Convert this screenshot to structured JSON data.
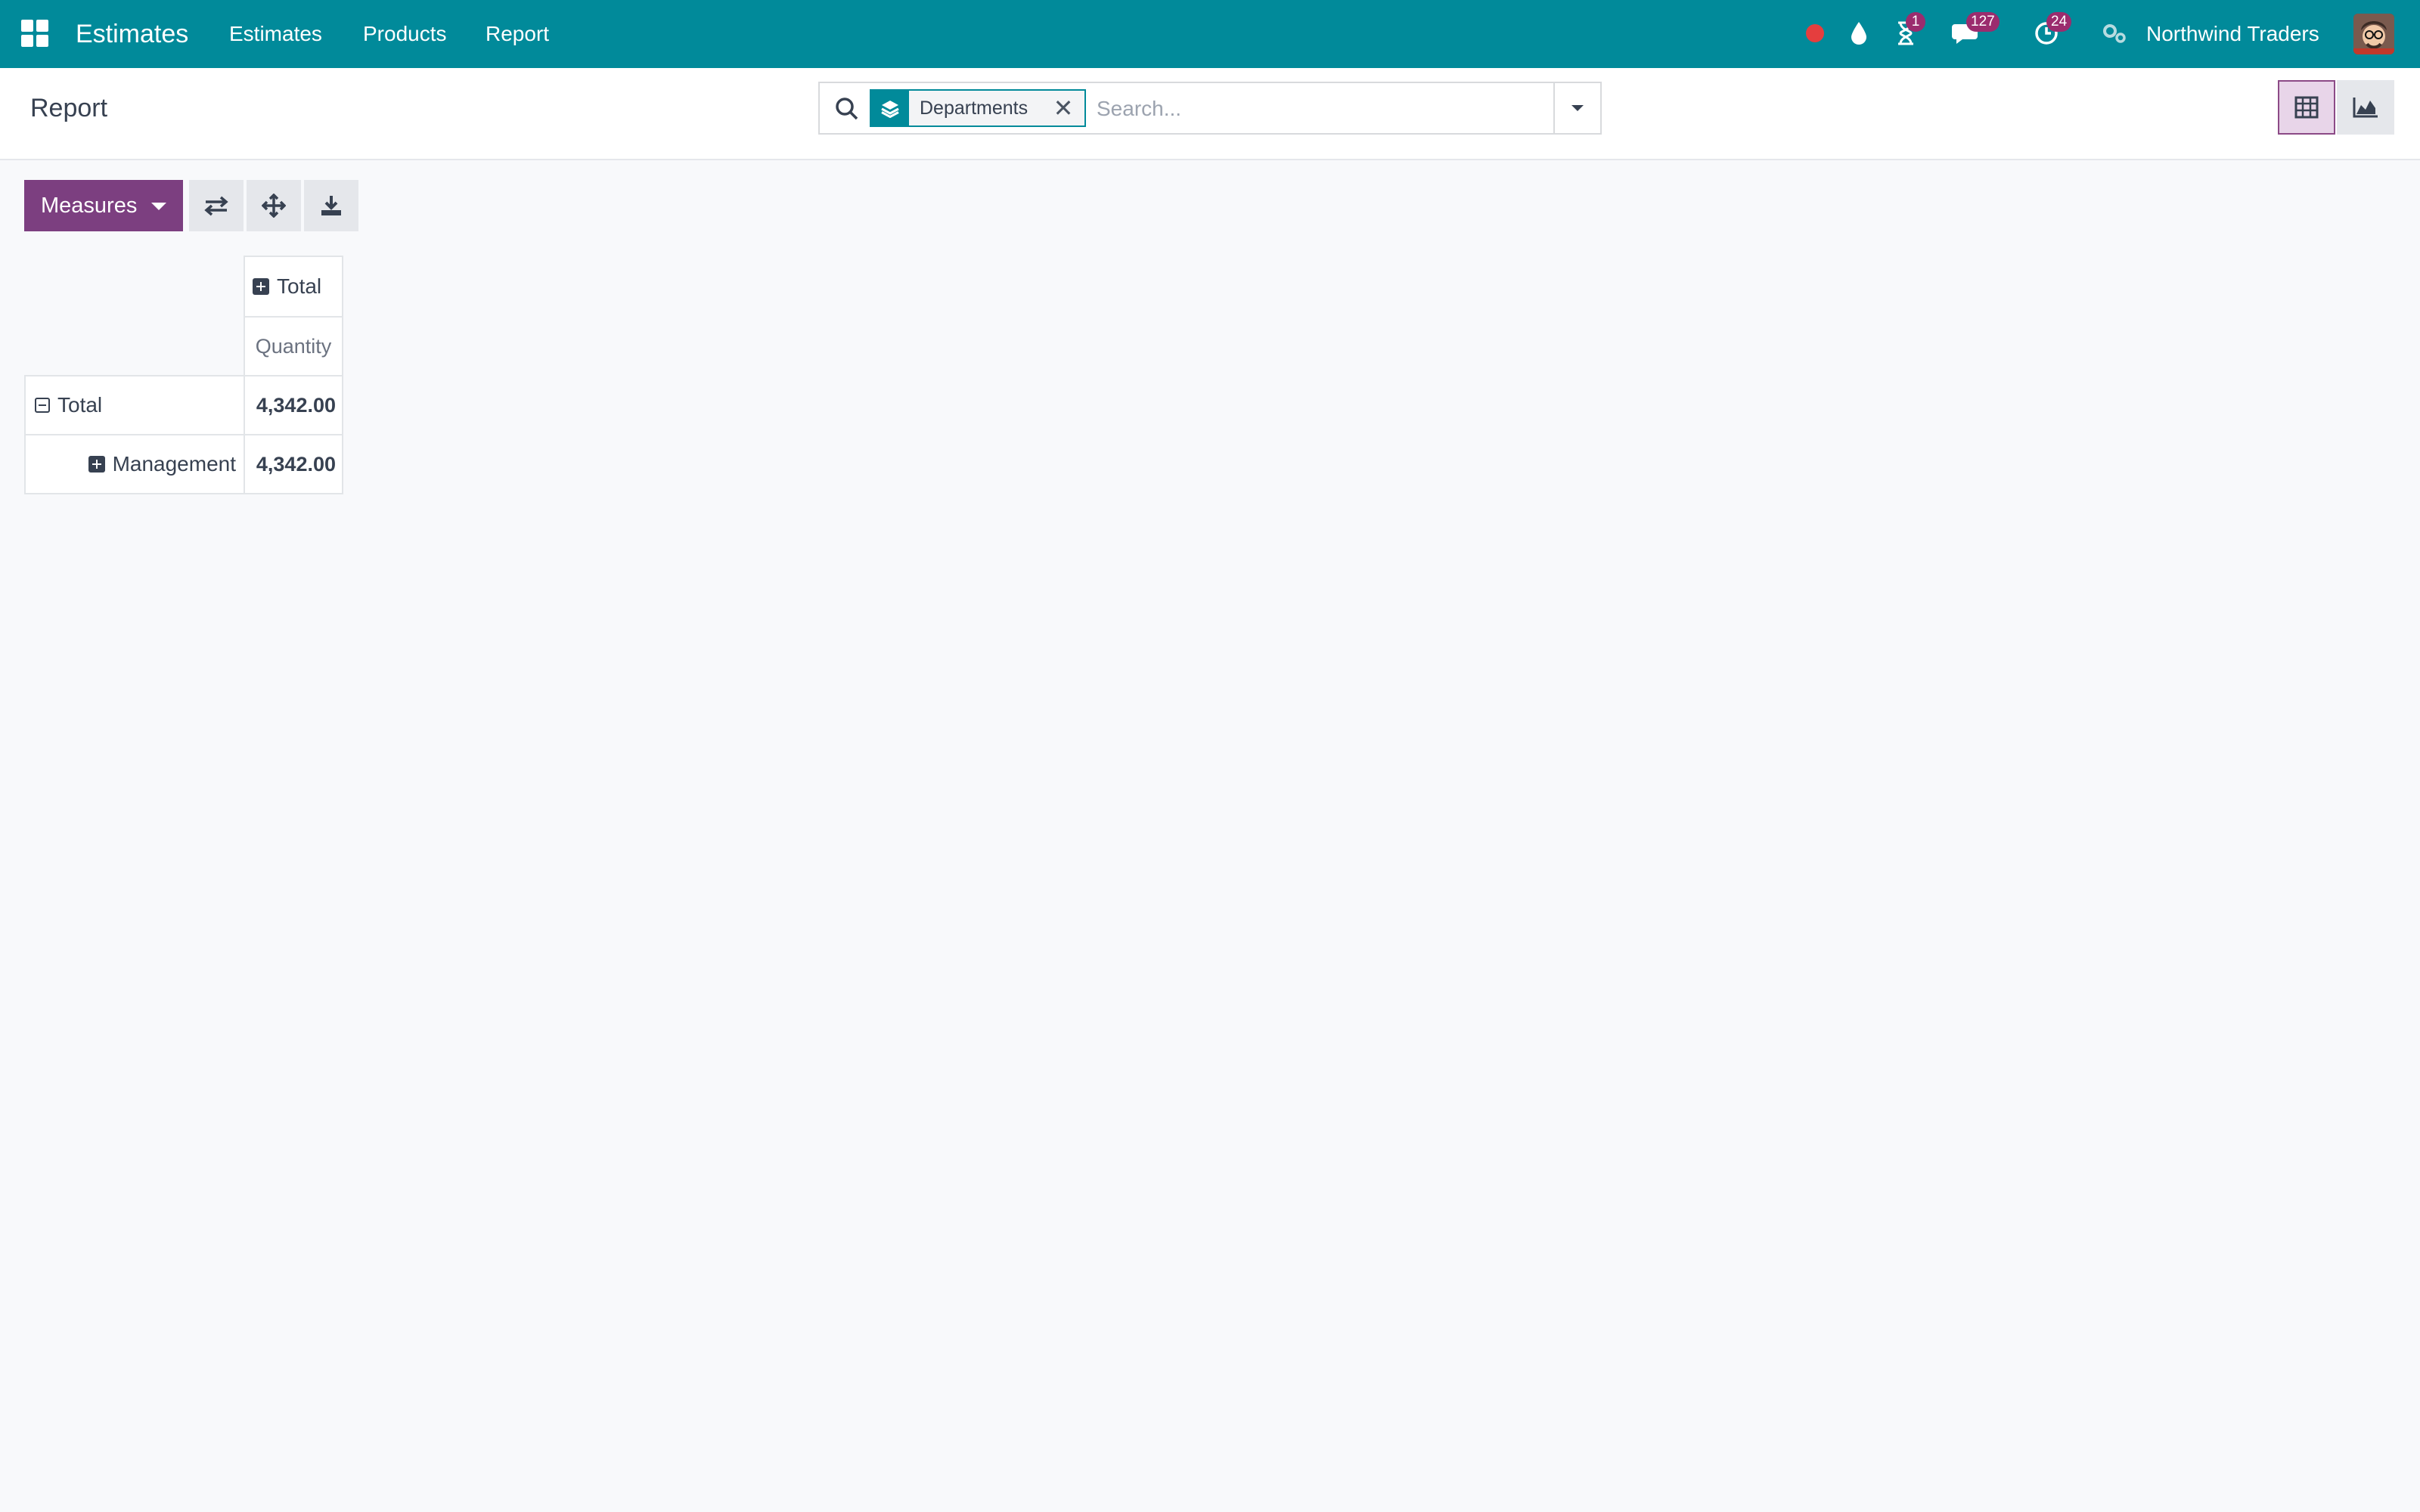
{
  "navbar": {
    "app_name": "Estimates",
    "menu": [
      "Estimates",
      "Products",
      "Report"
    ],
    "icons": [
      "apps-grid-icon",
      "recording-dot-icon",
      "droplet-icon",
      "hourglass-icon",
      "chat-icon",
      "clock-icon",
      "settings-gears-icon"
    ],
    "badges": {
      "hourglass": "1",
      "chat": "127",
      "clock": "24"
    },
    "company": "Northwind Traders",
    "colors": {
      "bar": "#018a9a",
      "badge": "#9b2c6e",
      "recording": "#e53e3e"
    }
  },
  "control_panel": {
    "title": "Report",
    "search": {
      "facet_label": "Departments",
      "facet_icon": "layers-icon",
      "placeholder": "Search..."
    },
    "views": [
      "pivot-view-icon",
      "graph-view-icon"
    ],
    "active_view": "pivot"
  },
  "toolbar": {
    "measures_label": "Measures",
    "buttons": [
      "flip-axis-icon",
      "expand-all-icon",
      "download-icon"
    ],
    "accent": "#7c3f80"
  },
  "pivot": {
    "column_header": "Total",
    "measure": "Quantity",
    "rows": [
      {
        "label": "Total",
        "value": "4,342.00",
        "expanded": true
      },
      {
        "label": "Management",
        "value": "4,342.00",
        "expanded": false
      }
    ]
  }
}
